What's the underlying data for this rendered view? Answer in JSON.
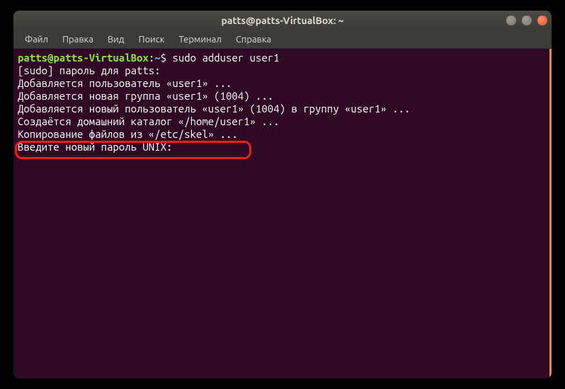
{
  "titlebar": {
    "title": "patts@patts-VirtualBox: ~"
  },
  "menu": {
    "file": "Файл",
    "edit": "Правка",
    "view": "Вид",
    "search": "Поиск",
    "terminal": "Терминал",
    "help": "Справка"
  },
  "prompt": {
    "userhost": "patts@patts-VirtualBox",
    "colon": ":",
    "path": "~",
    "dollar": "$ "
  },
  "command": "sudo adduser user1",
  "output": {
    "l1": "[sudo] пароль для patts: ",
    "l2": "Добавляется пользователь «user1» ...",
    "l3": "Добавляется новая группа «user1» (1004) ...",
    "l4": "Добавляется новый пользователь «user1» (1004) в группу «user1» ...",
    "l5": "Создаётся домашний каталог «/home/user1» ...",
    "l6": "Копирование файлов из «/etc/skel» ...",
    "l7": "Введите новый пароль UNIX: "
  }
}
